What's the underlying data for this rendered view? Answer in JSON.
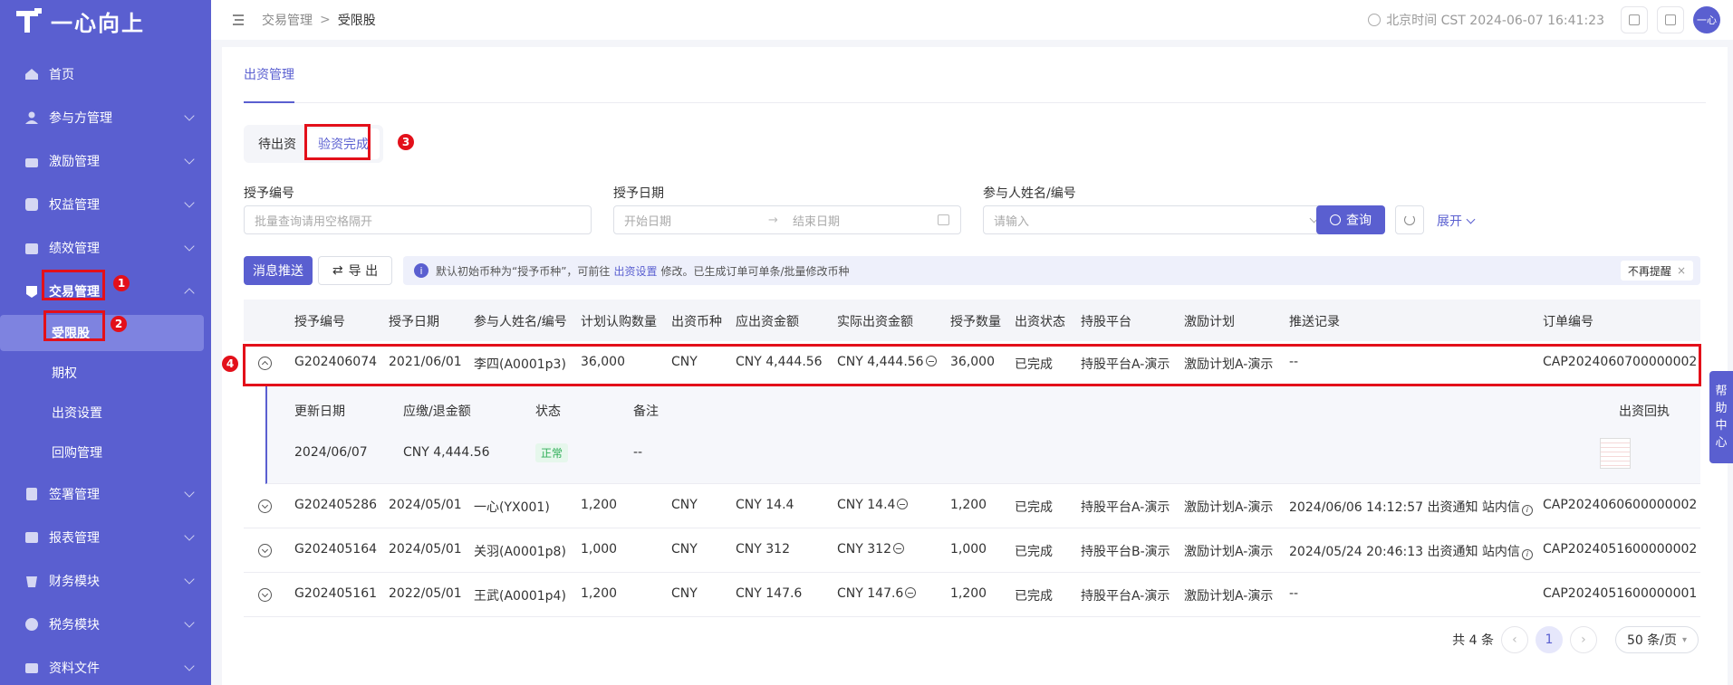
{
  "app": {
    "logo_text": "一心向上"
  },
  "sidebar": {
    "items": [
      {
        "label": "首页",
        "icon": "home-icon"
      },
      {
        "label": "参与方管理",
        "icon": "users-icon"
      },
      {
        "label": "激励管理",
        "icon": "gift-icon"
      },
      {
        "label": "权益管理",
        "icon": "equity-icon"
      },
      {
        "label": "绩效管理",
        "icon": "chart-icon"
      },
      {
        "label": "交易管理",
        "icon": "trade-icon"
      },
      {
        "label": "签署管理",
        "icon": "sign-icon"
      },
      {
        "label": "报表管理",
        "icon": "report-icon"
      },
      {
        "label": "财务模块",
        "icon": "finance-icon"
      },
      {
        "label": "税务模块",
        "icon": "tax-icon"
      },
      {
        "label": "资料文件",
        "icon": "file-icon"
      }
    ],
    "sub_items": [
      "受限股",
      "期权",
      "出资设置",
      "回购管理"
    ]
  },
  "annotations": [
    "1",
    "2",
    "3",
    "4"
  ],
  "header": {
    "breadcrumb": [
      "交易管理",
      "受限股"
    ],
    "clock": "北京时间 CST 2024-06-07 16:41:23",
    "avatar": "一心"
  },
  "page_tab": "出资管理",
  "segments": [
    "待出资",
    "验资完成"
  ],
  "filters": {
    "grant_no": {
      "label": "授予编号",
      "placeholder": "批量查询请用空格隔开"
    },
    "grant_date": {
      "label": "授予日期",
      "start": "开始日期",
      "end": "结束日期"
    },
    "participant": {
      "label": "参与人姓名/编号",
      "placeholder": "请输入"
    }
  },
  "buttons": {
    "query": "查询",
    "expand": "展开",
    "message_push": "消息推送",
    "export": "导 出"
  },
  "notice": {
    "text_before": "默认初始币种为“授予币种”，可前往",
    "link": "出资设置",
    "text_after": "修改。已生成订单可单条/批量修改币种",
    "dismiss": "不再提醒"
  },
  "table": {
    "columns": [
      "授予编号",
      "授予日期",
      "参与人姓名/编号",
      "计划认购数量",
      "出资币种",
      "应出资金额",
      "实际出资金额",
      "授予数量",
      "出资状态",
      "持股平台",
      "激励计划",
      "推送记录",
      "订单编号"
    ],
    "rows": [
      {
        "grant_no": "G202406074",
        "date": "2021/06/01",
        "participant": "李四(A0001p3)",
        "plan_qty": "36,000",
        "currency": "CNY",
        "due": "CNY 4,444.56",
        "actual": "CNY 4,444.56",
        "grant_qty": "36,000",
        "status": "已完成",
        "platform": "持股平台A-演示",
        "plan": "激励计划A-演示",
        "push": "--",
        "order": "CAP2024060700000002"
      },
      {
        "grant_no": "G202405286",
        "date": "2024/05/01",
        "participant": "一心(YX001)",
        "plan_qty": "1,200",
        "currency": "CNY",
        "due": "CNY 14.4",
        "actual": "CNY 14.4",
        "grant_qty": "1,200",
        "status": "已完成",
        "platform": "持股平台A-演示",
        "plan": "激励计划A-演示",
        "push": "2024/06/06 14:12:57 出资通知 站内信",
        "order": "CAP2024060600000002"
      },
      {
        "grant_no": "G202405164",
        "date": "2024/05/01",
        "participant": "关羽(A0001p8)",
        "plan_qty": "1,000",
        "currency": "CNY",
        "due": "CNY 312",
        "actual": "CNY 312",
        "grant_qty": "1,000",
        "status": "已完成",
        "platform": "持股平台B-演示",
        "plan": "激励计划A-演示",
        "push": "2024/05/24 20:46:13 出资通知 站内信",
        "order": "CAP2024051600000002"
      },
      {
        "grant_no": "G202405161",
        "date": "2022/05/01",
        "participant": "王武(A0001p4)",
        "plan_qty": "1,200",
        "currency": "CNY",
        "due": "CNY 147.6",
        "actual": "CNY 147.6",
        "grant_qty": "1,200",
        "status": "已完成",
        "platform": "持股平台A-演示",
        "plan": "激励计划A-演示",
        "push": "--",
        "order": "CAP2024051600000001"
      }
    ],
    "detail": {
      "columns": [
        "更新日期",
        "应缴/退金额",
        "状态",
        "备注",
        "出资回执"
      ],
      "row": {
        "date": "2024/06/07",
        "amount": "CNY 4,444.56",
        "status": "正常",
        "remark": "--"
      }
    }
  },
  "pager": {
    "total": "共 4 条",
    "page": "1",
    "size": "50 条/页"
  },
  "help": [
    "帮",
    "助",
    "中",
    "心"
  ]
}
